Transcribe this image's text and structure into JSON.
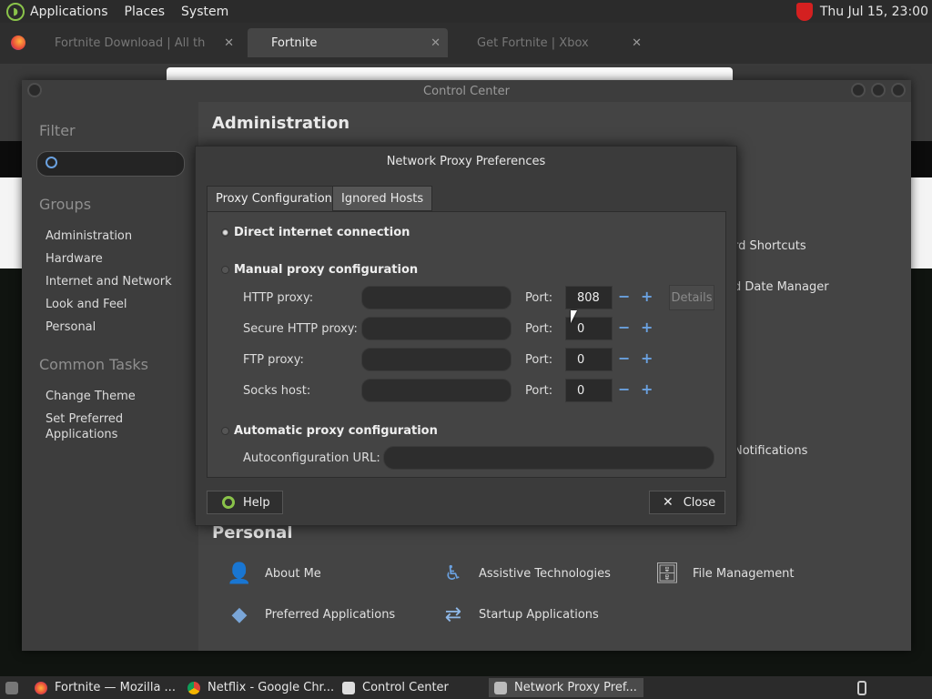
{
  "top_panel": {
    "menus": [
      "Applications",
      "Places",
      "System"
    ],
    "clock": "Thu Jul 15, 23:00"
  },
  "browser": {
    "tabs": [
      {
        "label": "Fortnite Download | All th",
        "active": false
      },
      {
        "label": "Fortnite",
        "active": true
      },
      {
        "label": "Get Fortnite | Xbox",
        "active": false
      }
    ]
  },
  "control_center": {
    "title": "Control Center",
    "filter_heading": "Filter",
    "groups_heading": "Groups",
    "groups": [
      "Administration",
      "Hardware",
      "Internet and Network",
      "Look and Feel",
      "Personal"
    ],
    "common_tasks_heading": "Common Tasks",
    "common_tasks": [
      "Change Theme",
      "Set Preferred Applications"
    ],
    "main": {
      "administration_heading": "Administration",
      "partial_items": [
        "rd Shortcuts",
        "d Date Manager",
        "Notifications"
      ],
      "personal_heading": "Personal",
      "personal_items": [
        "About Me",
        "Assistive Technologies",
        "File Management",
        "Preferred Applications",
        "Startup Applications"
      ]
    }
  },
  "dialog": {
    "title": "Network Proxy Preferences",
    "tabs": [
      "Proxy Configuration",
      "Ignored Hosts"
    ],
    "direct_label": "Direct internet connection",
    "manual_label": "Manual proxy configuration",
    "proxies": [
      {
        "label": "HTTP proxy:",
        "port_label": "Port:",
        "port": "808"
      },
      {
        "label": "Secure HTTP proxy:",
        "port_label": "Port:",
        "port": "0"
      },
      {
        "label": "FTP proxy:",
        "port_label": "Port:",
        "port": "0"
      },
      {
        "label": "Socks host:",
        "port_label": "Port:",
        "port": "0"
      }
    ],
    "details_label": "Details",
    "auto_label": "Automatic proxy configuration",
    "autoconfig_label": "Autoconfiguration URL:",
    "help_label": "Help",
    "close_label": "Close"
  },
  "taskbar": {
    "items": [
      {
        "label": "Fortnite — Mozilla ..."
      },
      {
        "label": "Netflix - Google Chr..."
      },
      {
        "label": "Control Center"
      },
      {
        "label": "Network Proxy Pref..."
      }
    ]
  },
  "colors": {
    "accent": "#6aa1e0",
    "help": "#8ac34a",
    "alert": "#d42020"
  }
}
